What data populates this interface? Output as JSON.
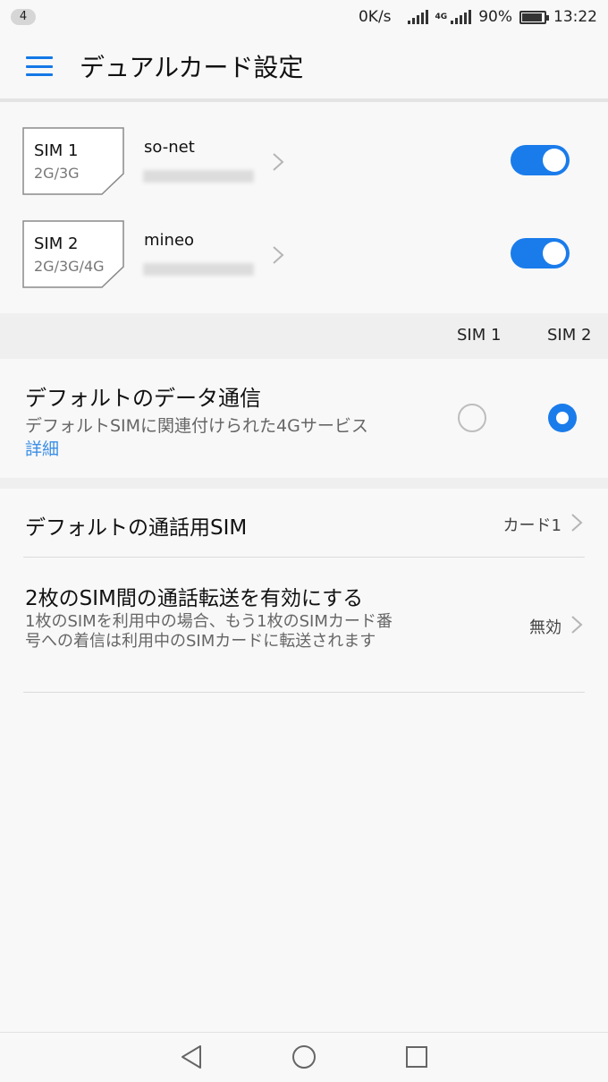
{
  "status_bar": {
    "notification_count": "4",
    "network_speed": "0K/s",
    "network_type": "4G",
    "battery_percent": "90%",
    "battery_level": 0.9,
    "time": "13:22"
  },
  "app_bar": {
    "menu_icon": "hamburger-menu-icon",
    "title": "デュアルカード設定"
  },
  "sims": [
    {
      "slot": "SIM 1",
      "type": "2G/3G",
      "carrier": "so-net",
      "enabled": true
    },
    {
      "slot": "SIM 2",
      "type": "2G/3G/4G",
      "carrier": "mineo",
      "enabled": true
    }
  ],
  "columns": {
    "sim1": "SIM 1",
    "sim2": "SIM 2"
  },
  "default_data": {
    "title": "デフォルトのデータ通信",
    "description": "デフォルトSIMに関連付けられた4Gサービス",
    "link": "詳細",
    "selected": "SIM 2"
  },
  "default_call": {
    "title": "デフォルトの通話用SIM",
    "value": "カード1"
  },
  "call_forwarding": {
    "title": "2枚のSIM間の通話転送を有効にする",
    "description": "1枚のSIMを利用中の場合、もう1枚のSIMカード番号への着信は利用中のSIMカードに転送されます",
    "value": "無効"
  },
  "colors": {
    "accent": "#1a7ceb",
    "link": "#3a8ee6"
  }
}
